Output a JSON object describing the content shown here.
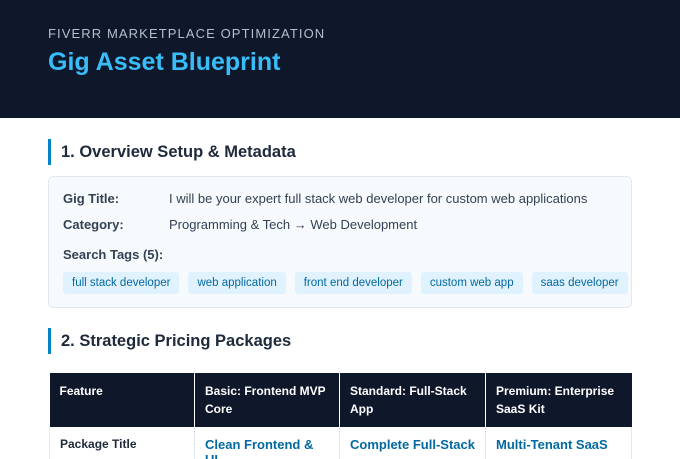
{
  "header": {
    "eyebrow": "FIVERR MARKETPLACE OPTIMIZATION",
    "title": "Gig Asset Blueprint"
  },
  "overview": {
    "heading": "1. Overview Setup & Metadata",
    "gig_title_label": "Gig Title:",
    "gig_title_value": "I will be your expert full stack web developer for custom web applications",
    "category_label": "Category:",
    "category_value": "Programming & Tech → Web Development",
    "tags_label": "Search Tags (5):",
    "tags": [
      "full stack developer",
      "web application",
      "front end developer",
      "custom web app",
      "saas developer"
    ]
  },
  "pricing": {
    "heading": "2. Strategic Pricing Packages",
    "columns": [
      "Feature",
      "Basic: Frontend MVP Core",
      "Standard: Full-Stack App",
      "Premium: Enterprise SaaS Kit"
    ],
    "rows": [
      {
        "feature": "Package Title",
        "basic": "Clean Frontend & UI",
        "standard": "Complete Full-Stack",
        "premium": "Multi-Tenant SaaS"
      }
    ]
  }
}
